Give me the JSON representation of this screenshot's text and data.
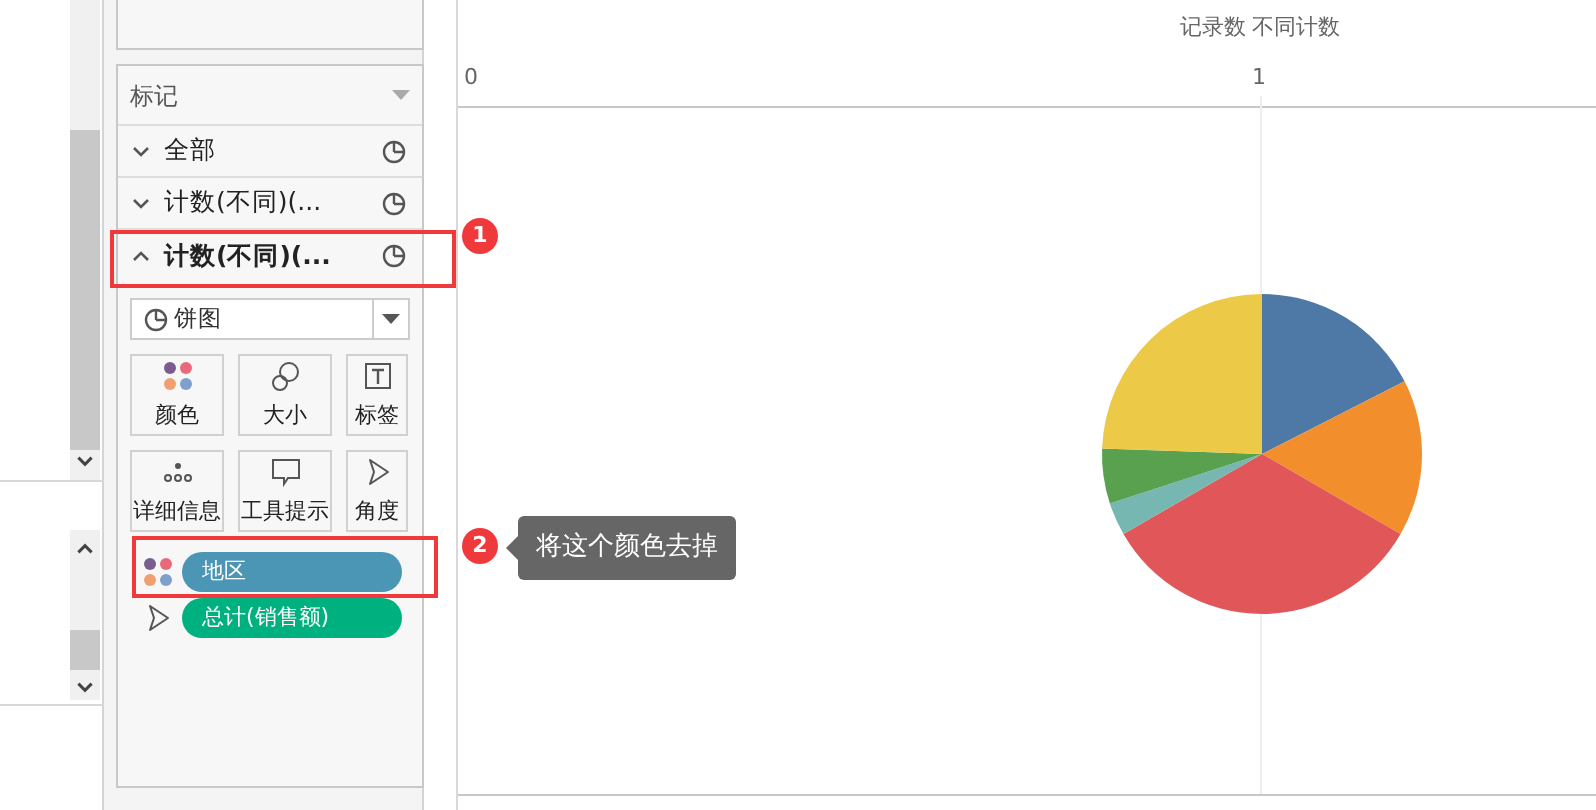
{
  "marks_panel": {
    "title": "标记",
    "layers": [
      {
        "label": "全部",
        "expanded": false
      },
      {
        "label": "计数(不同)(...",
        "expanded": false
      },
      {
        "label": "计数(不同)(...",
        "expanded": true
      }
    ],
    "mark_type": "饼图",
    "mark_buttons": [
      {
        "label": "颜色",
        "kind": "color"
      },
      {
        "label": "大小",
        "kind": "size"
      },
      {
        "label": "标签",
        "kind": "label"
      },
      {
        "label": "详细信息",
        "kind": "detail"
      },
      {
        "label": "工具提示",
        "kind": "tooltip"
      },
      {
        "label": "角度",
        "kind": "angle"
      }
    ],
    "pills": [
      {
        "label": "地区",
        "kind": "color",
        "color": "#4a96b4"
      },
      {
        "label": "总计(销售额)",
        "kind": "angle",
        "color": "#00b180"
      }
    ]
  },
  "chart": {
    "axis_title": "记录数 不同计数",
    "ticks": [
      "0",
      "1"
    ]
  },
  "annotations": [
    {
      "number": "1"
    },
    {
      "number": "2",
      "note": "将这个颜色去掉"
    }
  ]
}
